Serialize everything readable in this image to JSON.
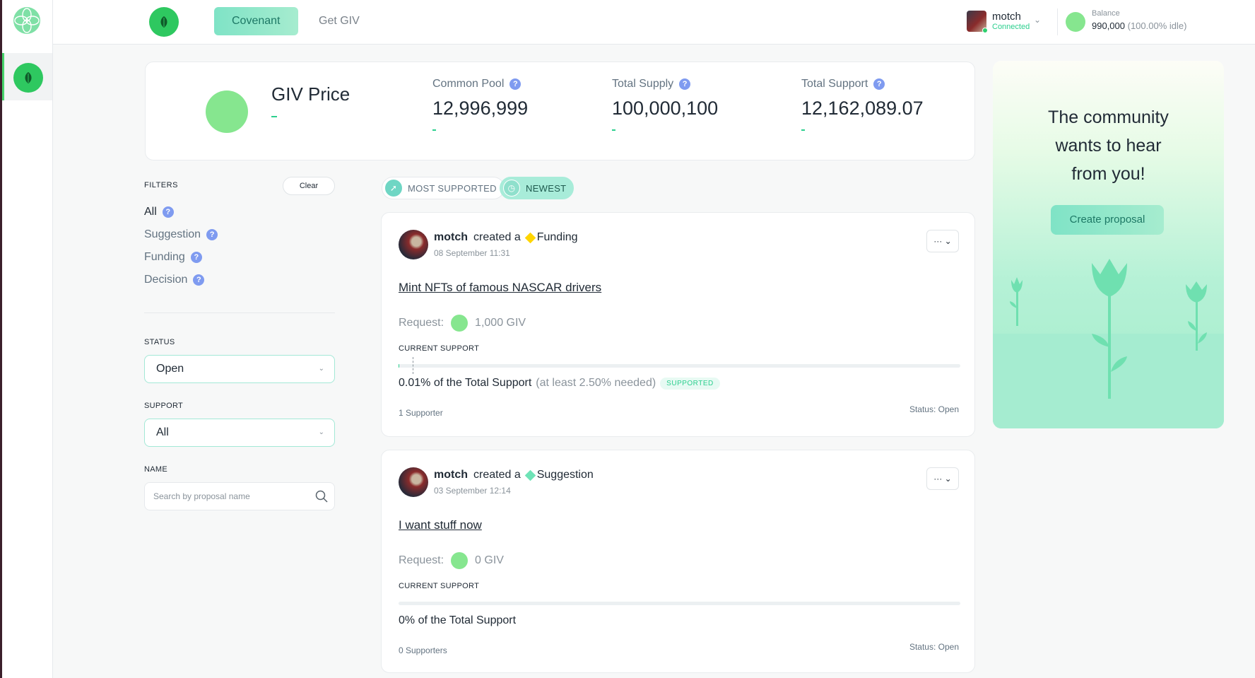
{
  "header": {
    "tabs": [
      "Covenant",
      "Get GIV"
    ],
    "user": {
      "name": "motch",
      "status": "Connected"
    },
    "balance": {
      "label": "Balance",
      "value": "990,000",
      "idle": "(100.00% idle)"
    }
  },
  "stats": {
    "giv_price_label": "GIV Price",
    "items": [
      {
        "label": "Common Pool",
        "value": "12,996,999"
      },
      {
        "label": "Total Supply",
        "value": "100,000,100"
      },
      {
        "label": "Total Support",
        "value": "12,162,089.07"
      }
    ]
  },
  "filters": {
    "title": "FILTERS",
    "clear": "Clear",
    "types": [
      "All",
      "Suggestion",
      "Funding",
      "Decision"
    ],
    "status_label": "STATUS",
    "status_value": "Open",
    "support_label": "SUPPORT",
    "support_value": "All",
    "name_label": "NAME",
    "search_placeholder": "Search by proposal name"
  },
  "sort": [
    "MOST SUPPORTED",
    "NEWEST"
  ],
  "proposals": [
    {
      "author": "motch",
      "action": "created a",
      "type": "Funding",
      "date": "08 September 11:31",
      "title": "Mint NFTs of famous NASCAR drivers",
      "request_label": "Request:",
      "request": "1,000 GIV",
      "support_label": "CURRENT SUPPORT",
      "support_pct": 0.0001,
      "threshold_pct": 0.025,
      "support_text": "0.01% of the Total Support",
      "needed": "(at least 2.50% needed)",
      "tag": "SUPPORTED",
      "supporters": "1 Supporter",
      "status": "Status: Open"
    },
    {
      "author": "motch",
      "action": "created a",
      "type": "Suggestion",
      "date": "03 September 12:14",
      "title": "I want stuff now",
      "request_label": "Request:",
      "request": "0 GIV",
      "support_label": "CURRENT SUPPORT",
      "support_pct": 0,
      "support_text": "0% of the Total Support",
      "supporters": "0 Supporters",
      "status": "Status: Open"
    }
  ],
  "promo": {
    "lines": [
      "The community",
      "wants to hear",
      "from you!"
    ],
    "button": "Create proposal"
  },
  "colors": {
    "accent": "#2ccf8e",
    "funding": "#ffd500",
    "suggestion": "#6fe3b7",
    "help": "#7f9bf0"
  },
  "icons": [
    "app-rail-logo",
    "leaf-icon",
    "help-icon",
    "search-icon",
    "chevron-down-icon",
    "more-icon"
  ]
}
